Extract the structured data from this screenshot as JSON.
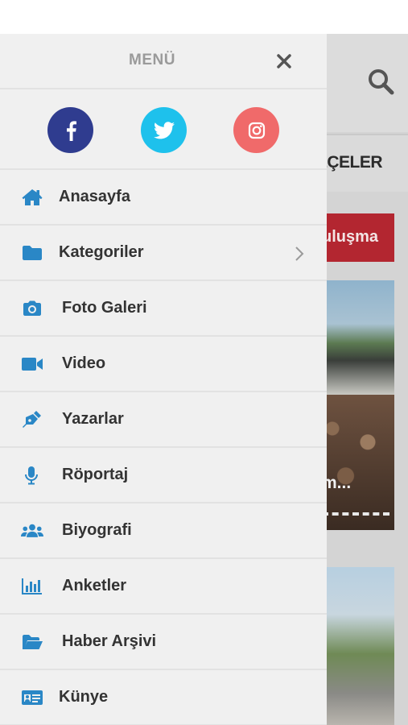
{
  "background": {
    "nav_label": "LÇELER",
    "banner_label": "uluşma",
    "card_title": "m...",
    "colors": {
      "banner": "#b32630"
    }
  },
  "drawer": {
    "title": "MENÜ",
    "close_icon": "close-icon",
    "socials": [
      {
        "name": "facebook",
        "icon": "facebook-icon",
        "color": "#2f3c8f"
      },
      {
        "name": "twitter",
        "icon": "twitter-icon",
        "color": "#1ec1ec"
      },
      {
        "name": "instagram",
        "icon": "instagram-icon",
        "color": "#f06a6a"
      }
    ],
    "items": [
      {
        "label": "Anasayfa",
        "icon": "home-icon"
      },
      {
        "label": "Kategoriler",
        "icon": "folder-icon",
        "has_submenu": true
      },
      {
        "label": "Foto Galeri",
        "icon": "camera-icon"
      },
      {
        "label": "Video",
        "icon": "video-camera-icon"
      },
      {
        "label": "Yazarlar",
        "icon": "pen-icon"
      },
      {
        "label": "Röportaj",
        "icon": "microphone-icon"
      },
      {
        "label": "Biyografi",
        "icon": "users-icon"
      },
      {
        "label": "Anketler",
        "icon": "bar-chart-icon"
      },
      {
        "label": "Haber Arşivi",
        "icon": "folder-open-icon"
      },
      {
        "label": "Künye",
        "icon": "id-card-icon"
      }
    ],
    "icon_color": "#2a87c6"
  }
}
